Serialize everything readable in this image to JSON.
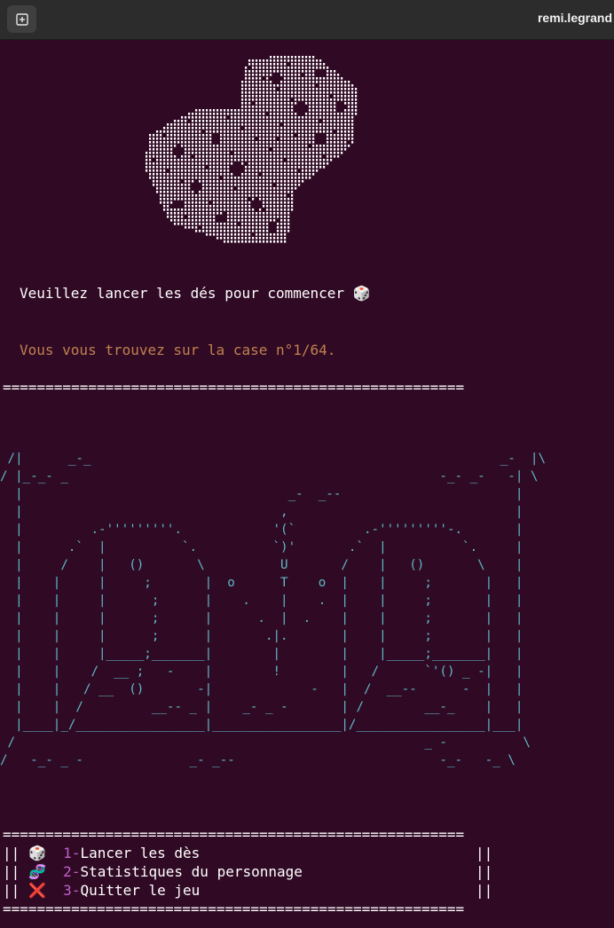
{
  "window": {
    "title": "remi.legrand",
    "new_tab_icon": "new-tab-icon"
  },
  "colors": {
    "background": "#300a24",
    "titlebar": "#2c2c2c",
    "text": "#ffffff",
    "status_text": "#c08050",
    "menu_number": "#c061cb",
    "inn_art": "#5fb8c8"
  },
  "terminal": {
    "prompt_message": "Veuillez lancer les dés pour commencer",
    "prompt_emoji": "🎲",
    "position_message": "Vous vous trouvez sur la case n°1/64.",
    "rule_line": "======================================================",
    "menu": {
      "items": [
        {
          "emoji": "🎲",
          "number": "1-",
          "label": "Lancer les dès"
        },
        {
          "emoji": "🧬",
          "number": "2-",
          "label": "Statistiques du personnage"
        },
        {
          "emoji": "❌",
          "number": "3-",
          "label": "Quitter le jeu"
        }
      ],
      "border_left": "||",
      "border_right": "||"
    }
  }
}
